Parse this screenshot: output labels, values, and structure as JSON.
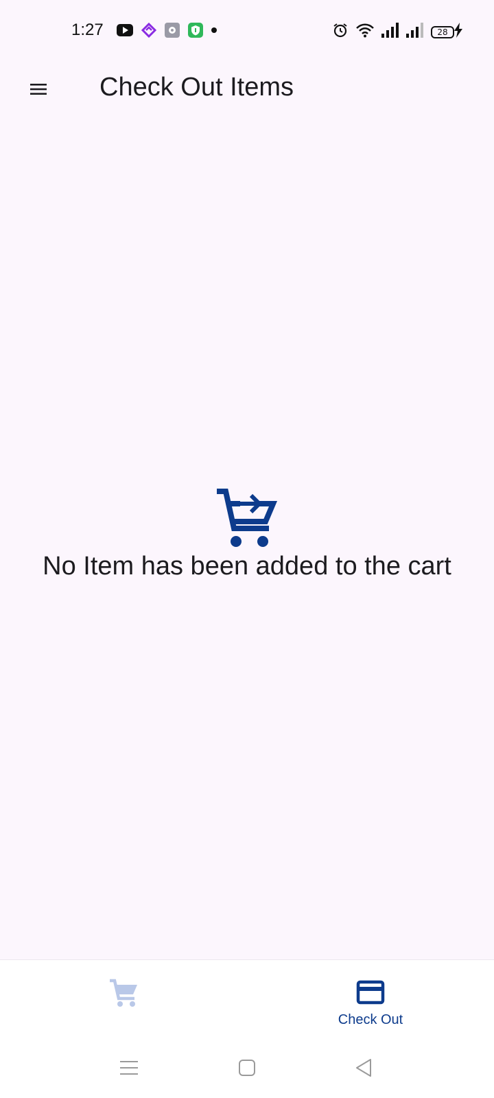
{
  "status_bar": {
    "time": "1:27",
    "battery": "28",
    "notification_icons": [
      "youtube-icon",
      "purple-app-icon",
      "settings-app-icon",
      "shield-app-icon",
      "dot-icon"
    ],
    "system_icons": [
      "alarm-icon",
      "wifi-icon",
      "signal-icon",
      "signal-icon",
      "battery-icon",
      "charging-icon"
    ]
  },
  "app_bar": {
    "menu_icon": "hamburger-menu-icon",
    "title": "Check Out Items"
  },
  "empty_state": {
    "icon": "cart-arrow-icon",
    "message": "No Item has been added to the cart"
  },
  "bottom_nav": {
    "items": [
      {
        "icon": "shopping-cart-icon",
        "label": "",
        "active": false
      },
      {
        "icon": "credit-card-icon",
        "label": "Check Out",
        "active": true
      }
    ]
  },
  "colors": {
    "background": "#fcf6fd",
    "accent": "#0d3b8c",
    "inactive_nav_icon": "#b9c8e8"
  }
}
